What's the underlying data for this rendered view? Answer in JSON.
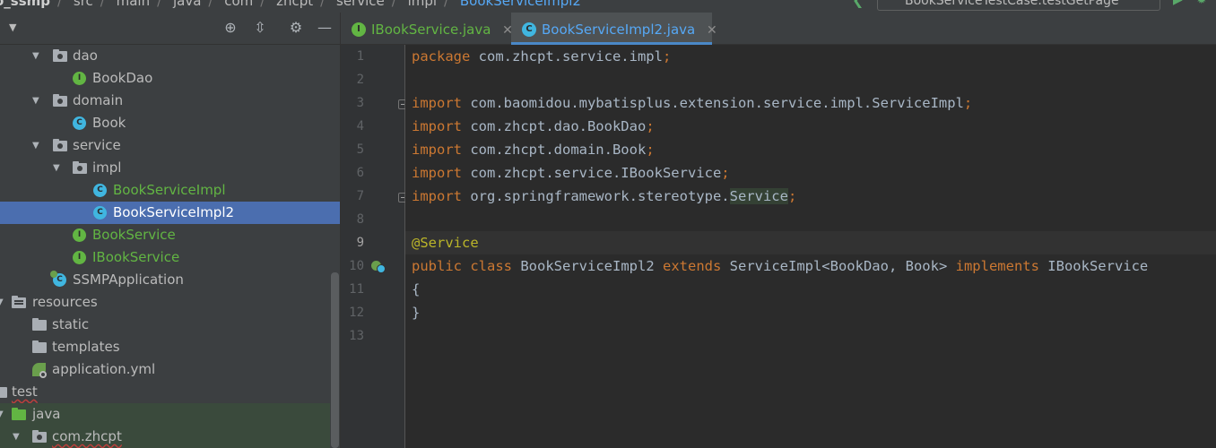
{
  "breadcrumb": {
    "project": "o_ssmp",
    "items": [
      "src",
      "main",
      "java",
      "com",
      "zhcpt",
      "service",
      "impl"
    ],
    "current": "BookServiceImpl2"
  },
  "run_config": {
    "label": "BookServiceTestCase.testGetPage"
  },
  "project_tree": {
    "items": [
      {
        "label": "dao",
        "kind": "package"
      },
      {
        "label": "BookDao",
        "kind": "interface"
      },
      {
        "label": "domain",
        "kind": "package"
      },
      {
        "label": "Book",
        "kind": "class"
      },
      {
        "label": "service",
        "kind": "package"
      },
      {
        "label": "impl",
        "kind": "package"
      },
      {
        "label": "BookServiceImpl",
        "kind": "class"
      },
      {
        "label": "BookServiceImpl2",
        "kind": "class",
        "selected": true
      },
      {
        "label": "BookService",
        "kind": "interface"
      },
      {
        "label": "IBookService",
        "kind": "interface"
      },
      {
        "label": "SSMPApplication",
        "kind": "spring-app"
      },
      {
        "label": "resources",
        "kind": "resource-folder"
      },
      {
        "label": "static",
        "kind": "folder"
      },
      {
        "label": "templates",
        "kind": "folder"
      },
      {
        "label": "application.yml",
        "kind": "config"
      },
      {
        "label": "test",
        "kind": "folder"
      },
      {
        "label": "java",
        "kind": "test-source-folder"
      },
      {
        "label": "com.zhcpt",
        "kind": "package"
      }
    ]
  },
  "tabs": [
    {
      "label": "IBookService.java",
      "icon": "I",
      "active": false
    },
    {
      "label": "BookServiceImpl2.java",
      "icon": "C",
      "active": true
    }
  ],
  "editor": {
    "current_line": 9,
    "lines": [
      {
        "n": "1",
        "segs": [
          {
            "t": "package",
            "c": "kw"
          },
          {
            "t": " com.zhcpt.service.impl"
          },
          {
            "t": ";",
            "c": "sc"
          }
        ]
      },
      {
        "n": "2",
        "segs": []
      },
      {
        "n": "3",
        "segs": [
          {
            "t": "import",
            "c": "kw"
          },
          {
            "t": " com.baomidou.mybatisplus.extension.service.impl.ServiceImpl"
          },
          {
            "t": ";",
            "c": "sc"
          }
        ]
      },
      {
        "n": "4",
        "segs": [
          {
            "t": "import",
            "c": "kw"
          },
          {
            "t": " com.zhcpt.dao.BookDao"
          },
          {
            "t": ";",
            "c": "sc"
          }
        ]
      },
      {
        "n": "5",
        "segs": [
          {
            "t": "import",
            "c": "kw"
          },
          {
            "t": " com.zhcpt.domain.Book"
          },
          {
            "t": ";",
            "c": "sc"
          }
        ]
      },
      {
        "n": "6",
        "segs": [
          {
            "t": "import",
            "c": "kw"
          },
          {
            "t": " com.zhcpt.service.IBookService"
          },
          {
            "t": ";",
            "c": "sc"
          }
        ]
      },
      {
        "n": "7",
        "segs": [
          {
            "t": "import",
            "c": "kw"
          },
          {
            "t": " org.springframework.stereotype."
          },
          {
            "t": "Service",
            "c": "hlw"
          },
          {
            "t": ";",
            "c": "sc"
          }
        ]
      },
      {
        "n": "8",
        "segs": []
      },
      {
        "n": "9",
        "segs": [
          {
            "t": "@Service",
            "c": "ann"
          }
        ]
      },
      {
        "n": "10",
        "segs": [
          {
            "t": "public",
            "c": "kw"
          },
          {
            "t": " "
          },
          {
            "t": "class",
            "c": "kw"
          },
          {
            "t": " BookServiceImpl2 "
          },
          {
            "t": "extends",
            "c": "kw"
          },
          {
            "t": " ServiceImpl<BookDao, Book> "
          },
          {
            "t": "implements",
            "c": "kw"
          },
          {
            "t": " IBookService"
          }
        ]
      },
      {
        "n": "11",
        "segs": [
          {
            "t": "{"
          }
        ]
      },
      {
        "n": "12",
        "segs": [
          {
            "t": "}"
          }
        ]
      },
      {
        "n": "13",
        "segs": []
      }
    ]
  },
  "colors": {
    "background": "#2b2b2b",
    "panel": "#3c3f41",
    "selection": "#4b6eaf",
    "keyword": "#cc7832",
    "annotation": "#bbb529",
    "interface_green": "#62b543",
    "class_blue": "#40b6e0"
  }
}
